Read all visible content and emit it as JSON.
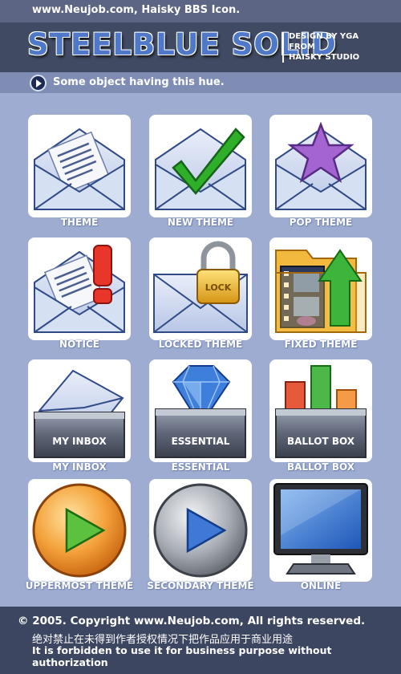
{
  "header": {
    "site_line": "www.Neujob.com, Haisky BBS Icon.",
    "title": "STEELBLUE SOLID",
    "credits": [
      "DESIGN BY YGA",
      "FROM",
      "HAISKY STUDIO"
    ],
    "subtitle": "Some object having this hue."
  },
  "icons": [
    {
      "label": "THEME",
      "icon": "envelope-letter-icon"
    },
    {
      "label": "NEW THEME",
      "icon": "envelope-checkmark-icon"
    },
    {
      "label": "POP THEME",
      "icon": "envelope-star-icon"
    },
    {
      "label": "NOTICE",
      "icon": "envelope-exclamation-icon"
    },
    {
      "label": "LOCKED THEME",
      "icon": "envelope-padlock-icon",
      "lock_text": "LOCK"
    },
    {
      "label": "FIXED THEME",
      "icon": "folder-arrow-icon"
    },
    {
      "label": "MY INBOX",
      "icon": "inbox-tray-icon",
      "tray_text": "MY INBOX"
    },
    {
      "label": "ESSENTIAL",
      "icon": "gem-tray-icon",
      "tray_text": "ESSENTIAL"
    },
    {
      "label": "BALLOT BOX",
      "icon": "bar-chart-tray-icon",
      "tray_text": "BALLOT BOX"
    },
    {
      "label": "UPPERMOST THEME",
      "icon": "orange-play-orb-icon"
    },
    {
      "label": "SECONDARY THEME",
      "icon": "silver-play-orb-icon"
    },
    {
      "label": "ONLINE",
      "icon": "monitor-icon"
    }
  ],
  "footer": {
    "copyright": "© 2005. Copyright www.Neujob.com, All rights reserved.",
    "notice_cn": "绝对禁止在未得到作者授权情况下把作品应用于商业用途",
    "notice_en": "It is forbidden to use it for business purpose without authorization"
  },
  "colors": {
    "background": "#9dacd0",
    "banner": "#404a62",
    "title_blue": "#4f79c8",
    "footer": "#3d4661"
  }
}
